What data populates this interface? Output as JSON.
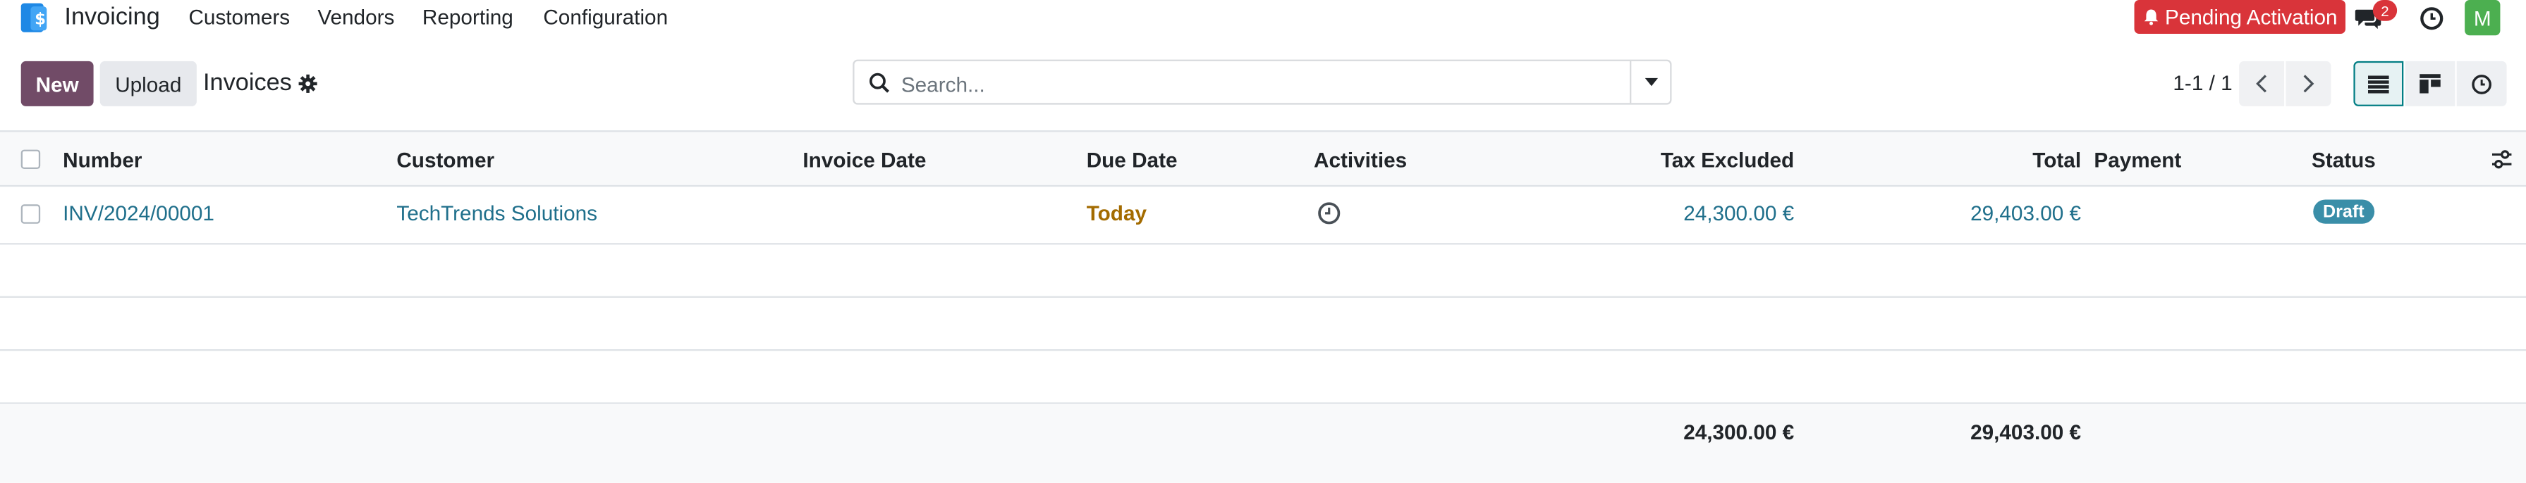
{
  "navbar": {
    "app_name": "Invoicing",
    "menu": [
      "Customers",
      "Vendors",
      "Reporting",
      "Configuration"
    ],
    "pending_label": "Pending Activation",
    "messages_count": "2",
    "avatar_initial": "M"
  },
  "control": {
    "new_label": "New",
    "upload_label": "Upload",
    "title": "Invoices",
    "search_placeholder": "Search...",
    "pager": "1-1 / 1"
  },
  "table": {
    "headers": {
      "number": "Number",
      "customer": "Customer",
      "invoice_date": "Invoice Date",
      "due_date": "Due Date",
      "activities": "Activities",
      "tax_excluded": "Tax Excluded",
      "total": "Total",
      "payment": "Payment",
      "status": "Status"
    },
    "rows": [
      {
        "number": "INV/2024/00001",
        "customer": "TechTrends Solutions",
        "invoice_date": "",
        "due_date": "Today",
        "tax_excluded": "24,300.00 €",
        "total": "29,403.00 €",
        "payment": "",
        "status": "Draft"
      }
    ],
    "totals": {
      "tax_excluded": "24,300.00 €",
      "total": "29,403.00 €"
    }
  },
  "colors": {
    "primary": "#714b67",
    "pending": "#d9343a",
    "link": "#1f6f8b",
    "today": "#a36b00",
    "draft": "#3a8ea8",
    "avatar": "#4caf50"
  }
}
